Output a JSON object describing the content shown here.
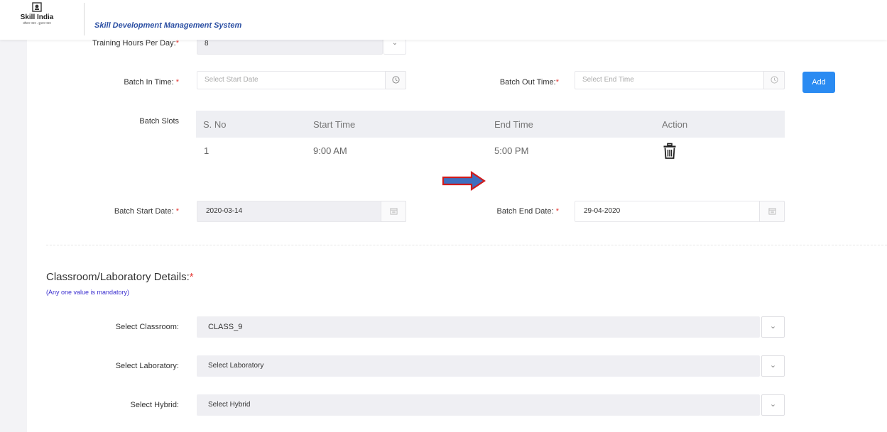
{
  "header": {
    "logo_text": "Skill India",
    "logo_tagline": "कौशल भारत - कुशल भारत",
    "app_title": "Skill Development Management System"
  },
  "form": {
    "training_hours": {
      "label": "Training Hours Per Day:",
      "required_mark": "*",
      "value": "8"
    },
    "batch_in_time": {
      "label": "Batch In Time:",
      "required_mark": "*",
      "placeholder": "Select Start Date"
    },
    "batch_out_time": {
      "label": "Batch Out Time:",
      "required_mark": "*",
      "placeholder": "Select End Time"
    },
    "add_button": "Add",
    "batch_slots": {
      "label": "Batch Slots",
      "columns": [
        "S. No",
        "Start Time",
        "End Time",
        "Action"
      ],
      "rows": [
        {
          "sno": "1",
          "start": "9:00 AM",
          "end": "5:00 PM"
        }
      ]
    },
    "batch_start_date": {
      "label": "Batch Start Date:",
      "required_mark": "*",
      "value": "2020-03-14"
    },
    "batch_end_date": {
      "label": "Batch End Date:",
      "required_mark": "*",
      "value": "29-04-2020"
    }
  },
  "classroom_section": {
    "title": "Classroom/Laboratory Details:",
    "required_mark": "*",
    "note": "(Any one value is mandatory)",
    "classroom": {
      "label": "Select Classroom:",
      "value": "CLASS_9"
    },
    "laboratory": {
      "label": "Select Laboratory:",
      "value": "Select Laboratory"
    },
    "hybrid": {
      "label": "Select Hybrid:",
      "value": "Select Hybrid"
    }
  },
  "icons": {
    "clock": "clock-icon",
    "calendar": "calendar-icon",
    "trash": "trash-icon",
    "chevron": "chevron-down-icon",
    "annotation_arrow": "right-arrow-annotation"
  },
  "colors": {
    "accent": "#2a8bf2",
    "title_blue": "#2b4fa3",
    "required": "#e53935",
    "note": "#3b2fcf",
    "arrow_fill": "#3f6fbf",
    "arrow_stroke": "#d01c1c"
  }
}
